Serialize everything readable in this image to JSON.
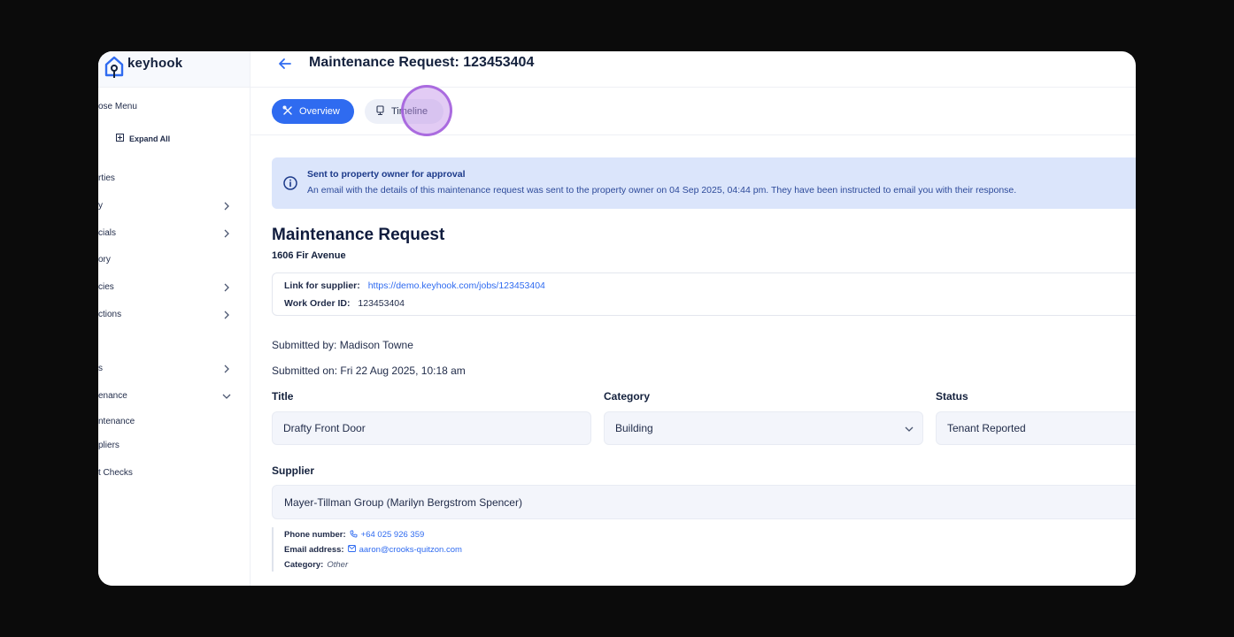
{
  "app": {
    "brand": "keyhook"
  },
  "sidebar": {
    "collapse_label": "ose Menu",
    "expand_all": "Expand All",
    "items": [
      {
        "label": "rties",
        "has_chevron": false
      },
      {
        "label": "y",
        "has_chevron": true,
        "chevron": "right"
      },
      {
        "label": "cials",
        "has_chevron": true,
        "chevron": "right"
      },
      {
        "label": "ory",
        "has_chevron": false
      },
      {
        "label": "cies",
        "has_chevron": true,
        "chevron": "right"
      },
      {
        "label": "ctions",
        "has_chevron": true,
        "chevron": "right"
      },
      {
        "label": "s",
        "has_chevron": true,
        "chevron": "right"
      },
      {
        "label": "enance",
        "has_chevron": true,
        "chevron": "down"
      },
      {
        "label": "ntenance",
        "has_chevron": false
      },
      {
        "label": "pliers",
        "has_chevron": false
      },
      {
        "label": "t Checks",
        "has_chevron": false
      }
    ]
  },
  "header": {
    "title": "Maintenance Request: 123453404"
  },
  "tabs": [
    {
      "label": "Overview",
      "active": true,
      "icon": "tools-icon"
    },
    {
      "label": "Timeline",
      "active": false,
      "icon": "timeline-icon"
    }
  ],
  "alert": {
    "title": "Sent to property owner for approval",
    "body": "An email with the details of this maintenance request was sent to the property owner on 04 Sep 2025, 04:44 pm. They have been instructed to email you with their response."
  },
  "request": {
    "heading": "Maintenance Request",
    "address": "1606 Fir Avenue",
    "supplier_link_label": "Link for supplier:",
    "supplier_link": "https://demo.keyhook.com/jobs/123453404",
    "work_order_label": "Work Order ID:",
    "work_order_id": "123453404",
    "submitted_by": "Submitted by: Madison Towne",
    "submitted_on": "Submitted on: Fri 22 Aug 2025, 10:18 am"
  },
  "form": {
    "title_label": "Title",
    "title_value": "Drafty Front Door",
    "category_label": "Category",
    "category_value": "Building",
    "status_label": "Status",
    "status_value": "Tenant Reported",
    "supplier_label": "Supplier",
    "supplier_value": "Mayer-Tillman Group (Marilyn Bergstrom Spencer)"
  },
  "supplier_details": {
    "phone_label": "Phone number:",
    "phone": "+64 025 926 359",
    "email_label": "Email address:",
    "email": "aaron@crooks-quitzon.com",
    "category_label": "Category:",
    "category": "Other"
  },
  "colors": {
    "accent": "#2f6bf0",
    "alert_bg": "#dbe5fb",
    "field_bg": "#f3f5fb",
    "cursor": "#a05adc"
  }
}
